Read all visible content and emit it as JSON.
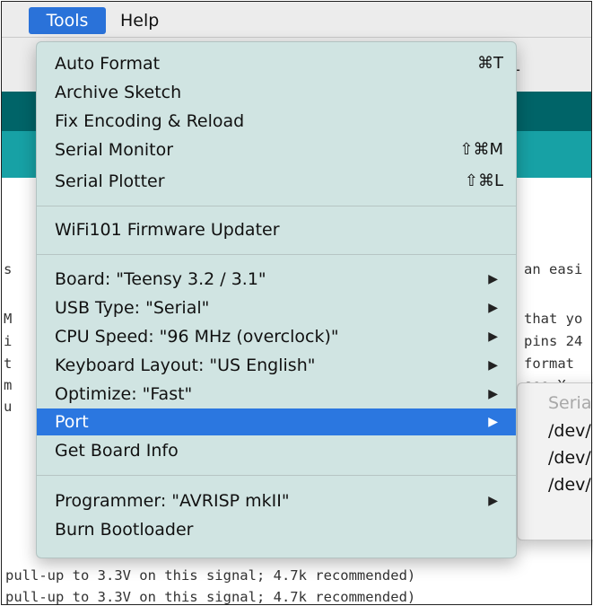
{
  "menubar": {
    "tools_label": "Tools",
    "help_label": "Help"
  },
  "ide": {
    "title_fragment": "1",
    "code_lines": [
      "s",
      "an easi",
      "M",
      "that yo",
      "i",
      "pins 24",
      "t",
      "format",
      "m",
      "see X.",
      "u",
      "pull-up to 3.3V on this signal; 4.7k recommended)",
      "pull-up to 3.3V on this signal; 4.7k recommended)"
    ]
  },
  "tools_menu": {
    "auto_format": "Auto Format",
    "auto_format_shortcut": "⌘T",
    "archive_sketch": "Archive Sketch",
    "fix_encoding": "Fix Encoding & Reload",
    "serial_monitor": "Serial Monitor",
    "serial_monitor_shortcut": "⇧⌘M",
    "serial_plotter": "Serial Plotter",
    "serial_plotter_shortcut": "⇧⌘L",
    "wifi_updater": "WiFi101 Firmware Updater",
    "board": "Board: \"Teensy 3.2 / 3.1\"",
    "usb_type": "USB Type: \"Serial\"",
    "cpu_speed": "CPU Speed: \"96 MHz (overclock)\"",
    "keyboard_layout": "Keyboard Layout: \"US English\"",
    "optimize": "Optimize: \"Fast\"",
    "port": "Port",
    "get_board_info": "Get Board Info",
    "programmer": "Programmer: \"AVRISP mkII\"",
    "burn_bootloader": "Burn Bootloader",
    "arrow_glyph": "▶"
  },
  "port_submenu": {
    "header": "Seria",
    "items": [
      "/dev/",
      "/dev/",
      "/dev/"
    ]
  },
  "colors": {
    "menu_highlight": "#2b77e0",
    "menu_background": "#d0e4e2",
    "ide_toolbar": "#006468",
    "ide_tabs": "#17a1a5"
  }
}
